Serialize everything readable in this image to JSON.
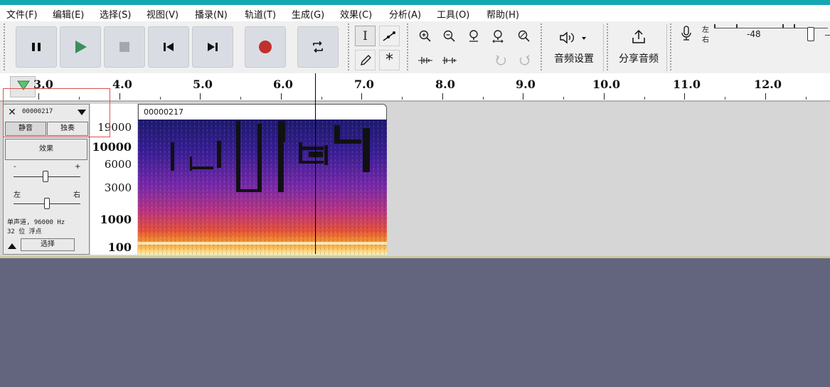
{
  "menu": [
    "文件(F)",
    "编辑(E)",
    "选择(S)",
    "视图(V)",
    "播录(N)",
    "轨道(T)",
    "生成(G)",
    "效果(C)",
    "分析(A)",
    "工具(O)",
    "帮助(H)"
  ],
  "toolbar": {
    "audio_setup_label": "音频设置",
    "share_audio_label": "分享音频",
    "meter": {
      "left_label": "左",
      "right_label": "右",
      "db_value": "-48"
    }
  },
  "ruler": {
    "labels": [
      "3.0",
      "4.0",
      "5.0",
      "6.0",
      "7.0",
      "8.0",
      "9.0",
      "10.0",
      "11.0",
      "12.0"
    ]
  },
  "track": {
    "name": "00000217",
    "mute_label": "静音",
    "solo_label": "独奏",
    "effects_label": "效果",
    "gain_minus": "-",
    "gain_plus": "+",
    "pan_left": "左",
    "pan_right": "右",
    "info_line1": "单声道, 96000 Hz",
    "info_line2": "32 位 浮点",
    "select_label": "选择",
    "clip_name": "00000217"
  },
  "freq_scale": [
    "19000",
    "10000",
    "6000",
    "3000",
    "1000",
    "100"
  ],
  "colors": {
    "accent": "#13a8b2",
    "record": "#c0312d",
    "play": "#3a8f5c",
    "background": "#63657f"
  }
}
